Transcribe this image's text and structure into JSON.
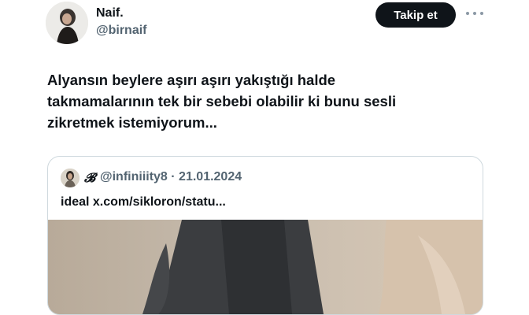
{
  "author": {
    "name": "Naif.",
    "handle": "@birnaif"
  },
  "header": {
    "follow_label": "Takip et"
  },
  "tweet": {
    "lines": [
      "Alyansın beylere aşırı aşırı yakıştığı halde",
      "takmamalarının tek bir sebebi olabilir ki bunu sesli",
      "zikretmek istemiyorum..."
    ]
  },
  "quote": {
    "name": "𝓑",
    "meta": "@infiniiity8 · 21.01.2024",
    "text": "ideal x.com/sikloron/statu..."
  },
  "icons": {
    "more": "more-horizontal-icon"
  },
  "colors": {
    "text": "#0f1419",
    "secondary": "#536471",
    "button_bg": "#0f1419",
    "border": "#cfd9de"
  }
}
